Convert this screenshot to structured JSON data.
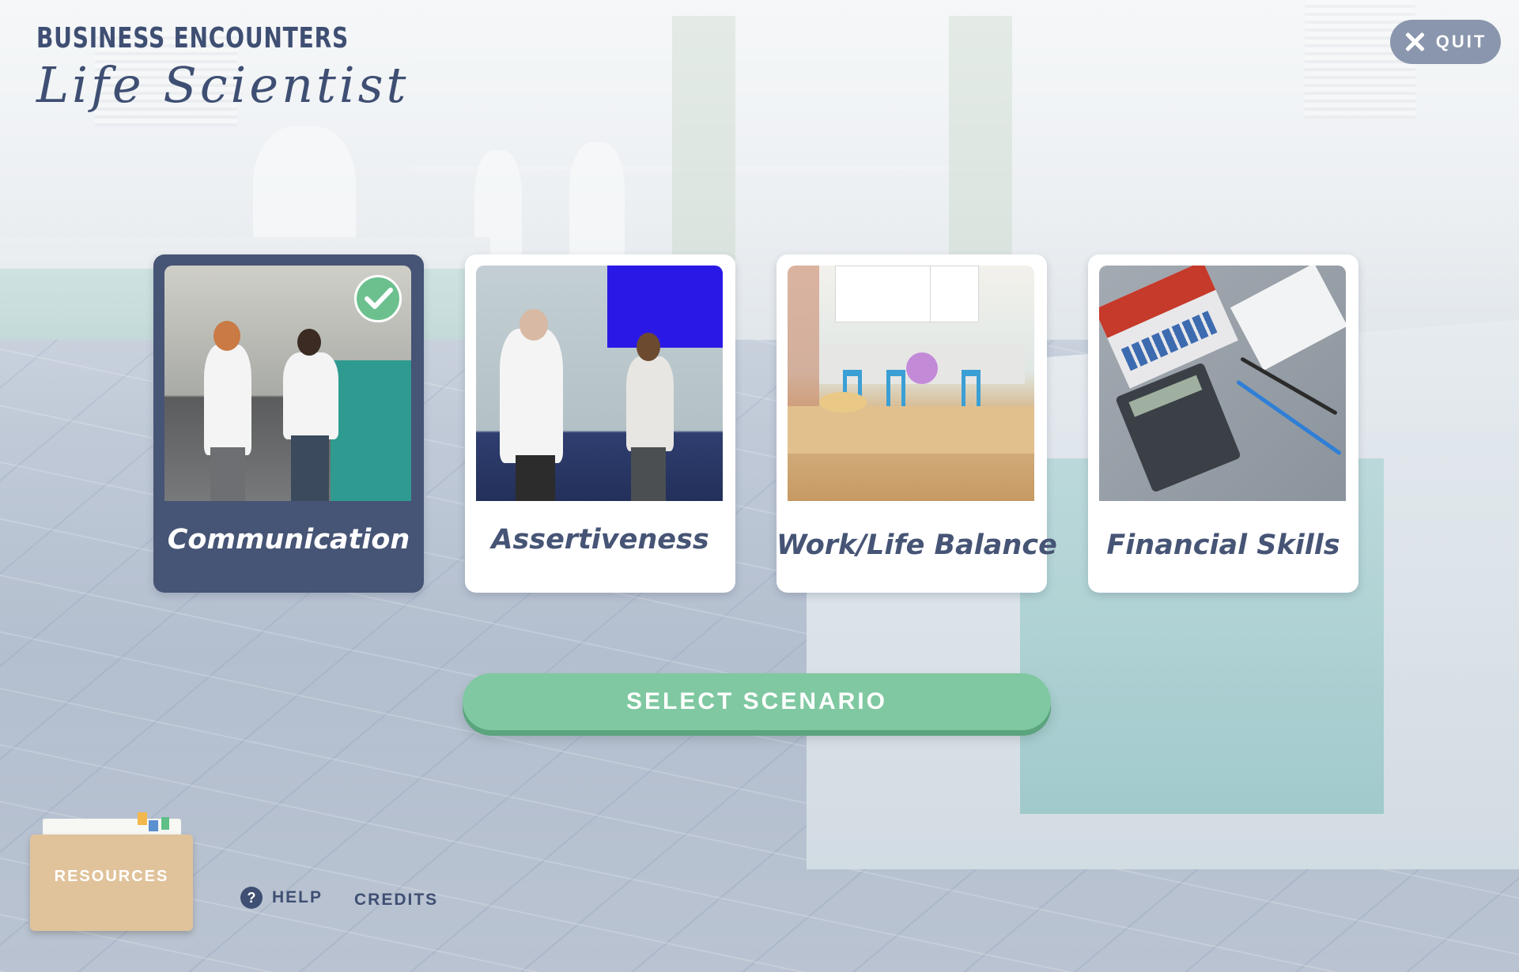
{
  "header": {
    "overline": "BUSINESS ENCOUNTERS",
    "title": "Life Scientist",
    "quit_label": "QUIT"
  },
  "scenarios": [
    {
      "label": "Communication",
      "selected": true,
      "completed": true,
      "image": "lab-conversation"
    },
    {
      "label": "Assertiveness",
      "selected": false,
      "completed": false,
      "image": "office-meeting"
    },
    {
      "label": "Work/Life Balance",
      "selected": false,
      "completed": false,
      "image": "kitchen-table"
    },
    {
      "label": "Financial Skills",
      "selected": false,
      "completed": false,
      "image": "desk-calculator"
    }
  ],
  "select_button_label": "SELECT SCENARIO",
  "footer": {
    "resources_label": "RESOURCES",
    "help_label": "HELP",
    "credits_label": "CREDITS"
  },
  "colors": {
    "navy": "#465475",
    "title": "#3f4f73",
    "accent_green": "#7fc8a1",
    "check_green": "#6bc08e",
    "quit_bg": "#8a96ad",
    "folder": "#e0c39b"
  },
  "icons": {
    "quit": "close-icon",
    "completed": "checkmark-icon",
    "help": "question-icon",
    "resources": "folder-icon"
  }
}
